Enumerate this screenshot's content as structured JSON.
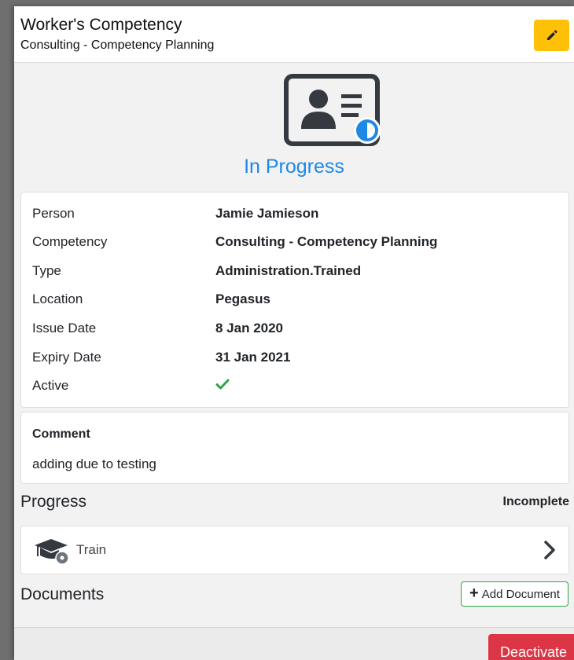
{
  "header": {
    "title": "Worker's Competency",
    "subtitle": "Consulting - Competency Planning",
    "edit_icon": "pencil-icon"
  },
  "status": {
    "icon": "id-card-half-filled-icon",
    "label": "In Progress",
    "color": "#1e88e5"
  },
  "details": [
    {
      "label": "Person",
      "value": "Jamie Jamieson"
    },
    {
      "label": "Competency",
      "value": "Consulting - Competency Planning"
    },
    {
      "label": "Type",
      "value": "Administration.Trained"
    },
    {
      "label": "Location",
      "value": "Pegasus"
    },
    {
      "label": "Issue Date",
      "value": "8 Jan 2020"
    },
    {
      "label": "Expiry Date",
      "value": "31 Jan 2021"
    },
    {
      "label": "Active",
      "value": ""
    }
  ],
  "active_icon": "checkmark-icon",
  "comment": {
    "label": "Comment",
    "text": "adding due to testing"
  },
  "progress": {
    "title": "Progress",
    "status": "Incomplete",
    "items": [
      {
        "label": "Train",
        "icon": "graduation-cap-icon"
      }
    ]
  },
  "documents": {
    "title": "Documents",
    "add_label": "Add Document"
  },
  "footer": {
    "deactivate_label": "Deactivate"
  },
  "colors": {
    "edit_button": "#ffc107",
    "deactivate_button": "#dc3545",
    "add_document_border": "#28a745",
    "check": "#28a745"
  }
}
